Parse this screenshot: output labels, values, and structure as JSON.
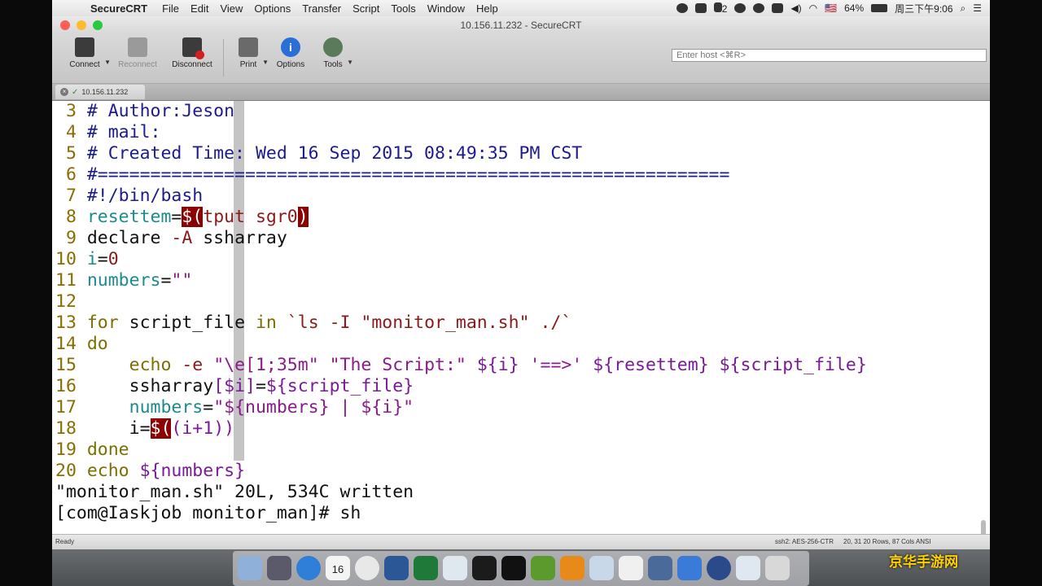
{
  "menubar": {
    "apple_glyph": "",
    "items": [
      "SecureCRT",
      "File",
      "Edit",
      "View",
      "Options",
      "Transfer",
      "Script",
      "Tools",
      "Window",
      "Help"
    ],
    "right": {
      "notif_count": "2",
      "flag": "🇺🇸",
      "battery": "64%",
      "clock": "周三下午9:06"
    }
  },
  "window": {
    "title": "10.156.11.232 - SecureCRT"
  },
  "toolbar": {
    "buttons": [
      {
        "label": "Connect",
        "icon": "monitor-icon"
      },
      {
        "label": "Reconnect",
        "icon": "monitor-refresh-icon"
      },
      {
        "label": "Disconnect",
        "icon": "monitor-x-icon"
      },
      {
        "label": "Print",
        "icon": "printer-icon"
      },
      {
        "label": "Options",
        "icon": "info-icon"
      },
      {
        "label": "Tools",
        "icon": "gear-icon"
      }
    ],
    "host_placeholder": "Enter host <⌘R>"
  },
  "tab": {
    "label": "10.156.11.232"
  },
  "colors": {
    "highlight_bg": "#8b0000",
    "comment": "#1c1c8e",
    "keyword": "#7a7000",
    "variable": "#1a8c8c",
    "string": "#8b1a8b"
  },
  "terminal": {
    "lines": [
      {
        "num": " 3",
        "parts": [
          {
            "t": "# Author:Jeson",
            "c": "c"
          }
        ]
      },
      {
        "num": " 4",
        "parts": [
          {
            "t": "# mail:",
            "c": "c"
          }
        ]
      },
      {
        "num": " 5",
        "parts": [
          {
            "t": "# Created Time: Wed 16 Sep 2015 08:49:35 PM CST",
            "c": "c"
          }
        ]
      },
      {
        "num": " 6",
        "parts": [
          {
            "t": "#============================================================",
            "c": "c"
          }
        ]
      },
      {
        "num": " 7",
        "parts": [
          {
            "t": "#!/bin/bash",
            "c": "c"
          }
        ]
      },
      {
        "num": " 8",
        "parts": [
          {
            "t": "resettem",
            "c": "v"
          },
          {
            "t": "=",
            "c": ""
          },
          {
            "t": "$(",
            "c": "hl"
          },
          {
            "t": "tput sgr0",
            "c": "r"
          },
          {
            "t": ")",
            "c": "hl"
          }
        ]
      },
      {
        "num": " 9",
        "parts": [
          {
            "t": "declare ",
            "c": ""
          },
          {
            "t": "-A",
            "c": "r"
          },
          {
            "t": " ssharray",
            "c": ""
          }
        ]
      },
      {
        "num": "10",
        "parts": [
          {
            "t": "i",
            "c": "v"
          },
          {
            "t": "=",
            "c": ""
          },
          {
            "t": "0",
            "c": "r"
          }
        ]
      },
      {
        "num": "11",
        "parts": [
          {
            "t": "numbers",
            "c": "v"
          },
          {
            "t": "=",
            "c": ""
          },
          {
            "t": "\"\"",
            "c": "s"
          }
        ]
      },
      {
        "num": "12",
        "parts": []
      },
      {
        "num": "13",
        "parts": [
          {
            "t": "for",
            "c": "k"
          },
          {
            "t": " script_file ",
            "c": ""
          },
          {
            "t": "in",
            "c": "k"
          },
          {
            "t": " `ls -I \"monitor_man.sh\" ./`",
            "c": "r"
          }
        ]
      },
      {
        "num": "14",
        "parts": [
          {
            "t": "do",
            "c": "k"
          }
        ]
      },
      {
        "num": "15",
        "parts": [
          {
            "t": "    ",
            "c": ""
          },
          {
            "t": "echo",
            "c": "k"
          },
          {
            "t": " ",
            "c": ""
          },
          {
            "t": "-e",
            "c": "r"
          },
          {
            "t": " ",
            "c": ""
          },
          {
            "t": "\"\\e[1;35m\" \"The Script:\"",
            "c": "s"
          },
          {
            "t": " ",
            "c": ""
          },
          {
            "t": "${i}",
            "c": "sp"
          },
          {
            "t": " ",
            "c": ""
          },
          {
            "t": "'==>'",
            "c": "s"
          },
          {
            "t": " ",
            "c": ""
          },
          {
            "t": "${resettem}",
            "c": "sp"
          },
          {
            "t": " ",
            "c": ""
          },
          {
            "t": "${script_file}",
            "c": "sp"
          }
        ]
      },
      {
        "num": "16",
        "parts": [
          {
            "t": "    ssharray",
            "c": ""
          },
          {
            "t": "[$i]",
            "c": "sp"
          },
          {
            "t": "=",
            "c": ""
          },
          {
            "t": "${script_file}",
            "c": "sp"
          }
        ]
      },
      {
        "num": "17",
        "parts": [
          {
            "t": "    ",
            "c": ""
          },
          {
            "t": "numbers",
            "c": "v"
          },
          {
            "t": "=",
            "c": ""
          },
          {
            "t": "\"${numbers} | ${i}\"",
            "c": "s"
          }
        ]
      },
      {
        "num": "18",
        "parts": [
          {
            "t": "    i=",
            "c": ""
          },
          {
            "t": "$(",
            "c": "hl"
          },
          {
            "t": "(i+1",
            "c": "sp"
          },
          {
            "t": "))",
            "c": "sp"
          }
        ]
      },
      {
        "num": "19",
        "parts": [
          {
            "t": "done",
            "c": "k"
          }
        ]
      },
      {
        "num": "20",
        "parts": [
          {
            "t": "echo",
            "c": "k"
          },
          {
            "t": " ",
            "c": ""
          },
          {
            "t": "${numbers}",
            "c": "sp"
          }
        ]
      }
    ],
    "written_msg": "\"monitor_man.sh\" 20L, 534C written",
    "prompt": "[com@Iaskjob monitor_man]# sh"
  },
  "statusbar": {
    "ready": "Ready",
    "cipher": "ssh2: AES-256-CTR",
    "position": "20, 31  20 Rows, 87 Cols  ANSI"
  },
  "dock": {
    "icons": [
      "finder-icon",
      "launchpad-icon",
      "safari-icon",
      "calendar-icon",
      "chrome-icon",
      "word-icon",
      "excel-icon",
      "preview-icon",
      "terminal-icon",
      "qq-icon",
      "pencil-app-icon",
      "unknown-app-icon",
      "photo-app-icon",
      "document-app-icon",
      "mail-app-icon",
      "keynote-icon",
      "quicktime-icon",
      "downloads-icon",
      "trash-icon"
    ],
    "calendar_day": "16"
  },
  "watermark": "京华手游网"
}
